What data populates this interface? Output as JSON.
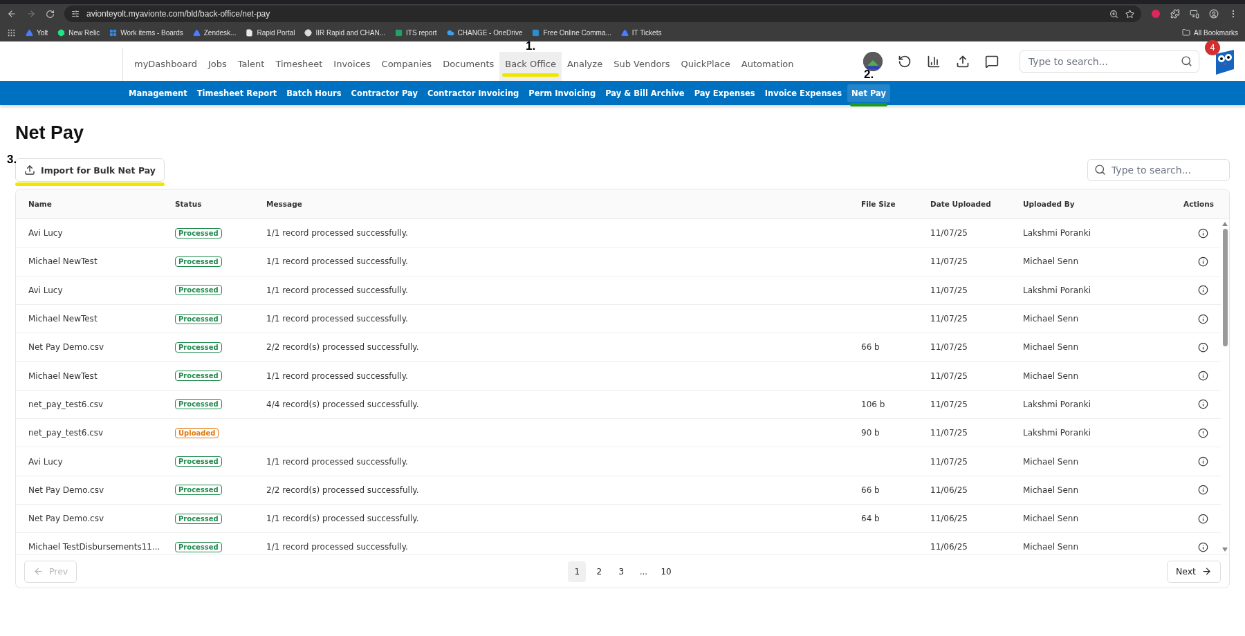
{
  "browser": {
    "url": "avionteyolt.myavionte.com/bld/back-office/net-pay",
    "bookmarks": [
      {
        "label": "Yolt"
      },
      {
        "label": "New Relic"
      },
      {
        "label": "Work items - Boards"
      },
      {
        "label": "Zendesk..."
      },
      {
        "label": "Rapid Portal"
      },
      {
        "label": "IIR Rapid and CHAN..."
      },
      {
        "label": "ITS report"
      },
      {
        "label": "CHANGE - OneDrive"
      },
      {
        "label": "Free Online Comma..."
      },
      {
        "label": "IT Tickets"
      }
    ],
    "all_bookmarks": "All Bookmarks"
  },
  "nav": {
    "items": [
      {
        "label": "myDashboard",
        "selected": false
      },
      {
        "label": "Jobs",
        "selected": false
      },
      {
        "label": "Talent",
        "selected": false
      },
      {
        "label": "Timesheet",
        "selected": false
      },
      {
        "label": "Invoices",
        "selected": false
      },
      {
        "label": "Companies",
        "selected": false
      },
      {
        "label": "Documents",
        "selected": false
      },
      {
        "label": "Back Office",
        "selected": true,
        "annotation": "1.",
        "color": "#f2e600"
      },
      {
        "label": "Analyze",
        "selected": false
      },
      {
        "label": "Sub Vendors",
        "selected": false
      },
      {
        "label": "QuickPlace",
        "selected": false
      },
      {
        "label": "Automation",
        "selected": false
      }
    ],
    "search": {
      "placeholder": "Type to search..."
    },
    "notification_count": "4"
  },
  "subnav": {
    "items": [
      {
        "label": "Management",
        "selected": false
      },
      {
        "label": "Timesheet Report",
        "selected": false
      },
      {
        "label": "Batch Hours",
        "selected": false
      },
      {
        "label": "Contractor Pay",
        "selected": false
      },
      {
        "label": "Contractor Invoicing",
        "selected": false
      },
      {
        "label": "Perm Invoicing",
        "selected": false
      },
      {
        "label": "Pay & Bill Archive",
        "selected": false
      },
      {
        "label": "Pay Expenses",
        "selected": false
      },
      {
        "label": "Invoice Expenses",
        "selected": false
      },
      {
        "label": "Net Pay",
        "selected": true,
        "annotation": "2.",
        "color": "#1f9a1f"
      }
    ]
  },
  "page": {
    "title": "Net Pay",
    "import_button": {
      "label": "Import for Bulk Net Pay",
      "annotation": "3.",
      "color": "#f2e600"
    },
    "search": {
      "placeholder": "Type to search..."
    }
  },
  "table": {
    "columns": [
      "Name",
      "Status",
      "Message",
      "File Size",
      "Date Uploaded",
      "Uploaded By",
      "Actions"
    ],
    "rows": [
      {
        "name": "Avi Lucy",
        "status": {
          "label": "Processed",
          "kind": "processed"
        },
        "message": "1/1 record processed successfully.",
        "file_size": "",
        "date": "11/07/25",
        "uploaded_by": "Lakshmi Poranki"
      },
      {
        "name": "Michael NewTest",
        "status": {
          "label": "Processed",
          "kind": "processed"
        },
        "message": "1/1 record processed successfully.",
        "file_size": "",
        "date": "11/07/25",
        "uploaded_by": "Michael Senn"
      },
      {
        "name": "Avi Lucy",
        "status": {
          "label": "Processed",
          "kind": "processed"
        },
        "message": "1/1 record processed successfully.",
        "file_size": "",
        "date": "11/07/25",
        "uploaded_by": "Lakshmi Poranki"
      },
      {
        "name": "Michael NewTest",
        "status": {
          "label": "Processed",
          "kind": "processed"
        },
        "message": "1/1 record processed successfully.",
        "file_size": "",
        "date": "11/07/25",
        "uploaded_by": "Michael Senn"
      },
      {
        "name": "Net Pay Demo.csv",
        "status": {
          "label": "Processed",
          "kind": "processed"
        },
        "message": "2/2 record(s) processed successfully.",
        "file_size": "66 b",
        "date": "11/07/25",
        "uploaded_by": "Michael Senn"
      },
      {
        "name": "Michael NewTest",
        "status": {
          "label": "Processed",
          "kind": "processed"
        },
        "message": "1/1 record processed successfully.",
        "file_size": "",
        "date": "11/07/25",
        "uploaded_by": "Michael Senn"
      },
      {
        "name": "net_pay_test6.csv",
        "status": {
          "label": "Processed",
          "kind": "processed"
        },
        "message": "4/4 record(s) processed successfully.",
        "file_size": "106 b",
        "date": "11/07/25",
        "uploaded_by": "Lakshmi Poranki"
      },
      {
        "name": "net_pay_test6.csv",
        "status": {
          "label": "Uploaded",
          "kind": "uploaded"
        },
        "message": "",
        "file_size": "90 b",
        "date": "11/07/25",
        "uploaded_by": "Lakshmi Poranki"
      },
      {
        "name": "Avi Lucy",
        "status": {
          "label": "Processed",
          "kind": "processed"
        },
        "message": "1/1 record processed successfully.",
        "file_size": "",
        "date": "11/07/25",
        "uploaded_by": "Michael Senn"
      },
      {
        "name": "Net Pay Demo.csv",
        "status": {
          "label": "Processed",
          "kind": "processed"
        },
        "message": "2/2 record(s) processed successfully.",
        "file_size": "66 b",
        "date": "11/06/25",
        "uploaded_by": "Michael Senn"
      },
      {
        "name": "Net Pay Demo.csv",
        "status": {
          "label": "Processed",
          "kind": "processed"
        },
        "message": "1/1 record(s) processed successfully.",
        "file_size": "64 b",
        "date": "11/06/25",
        "uploaded_by": "Michael Senn"
      },
      {
        "name": "Michael TestDisbursements11...",
        "status": {
          "label": "Processed",
          "kind": "processed"
        },
        "message": "1/1 record processed successfully.",
        "file_size": "",
        "date": "11/06/25",
        "uploaded_by": "Michael Senn"
      }
    ]
  },
  "pagination": {
    "prev": {
      "label": "Prev",
      "disabled": true
    },
    "next": {
      "label": "Next",
      "disabled": false
    },
    "pages": [
      {
        "label": "1",
        "selected": true
      },
      {
        "label": "2",
        "selected": false
      },
      {
        "label": "3",
        "selected": false
      },
      {
        "label": "...",
        "selected": false
      },
      {
        "label": "10",
        "selected": false
      }
    ]
  }
}
